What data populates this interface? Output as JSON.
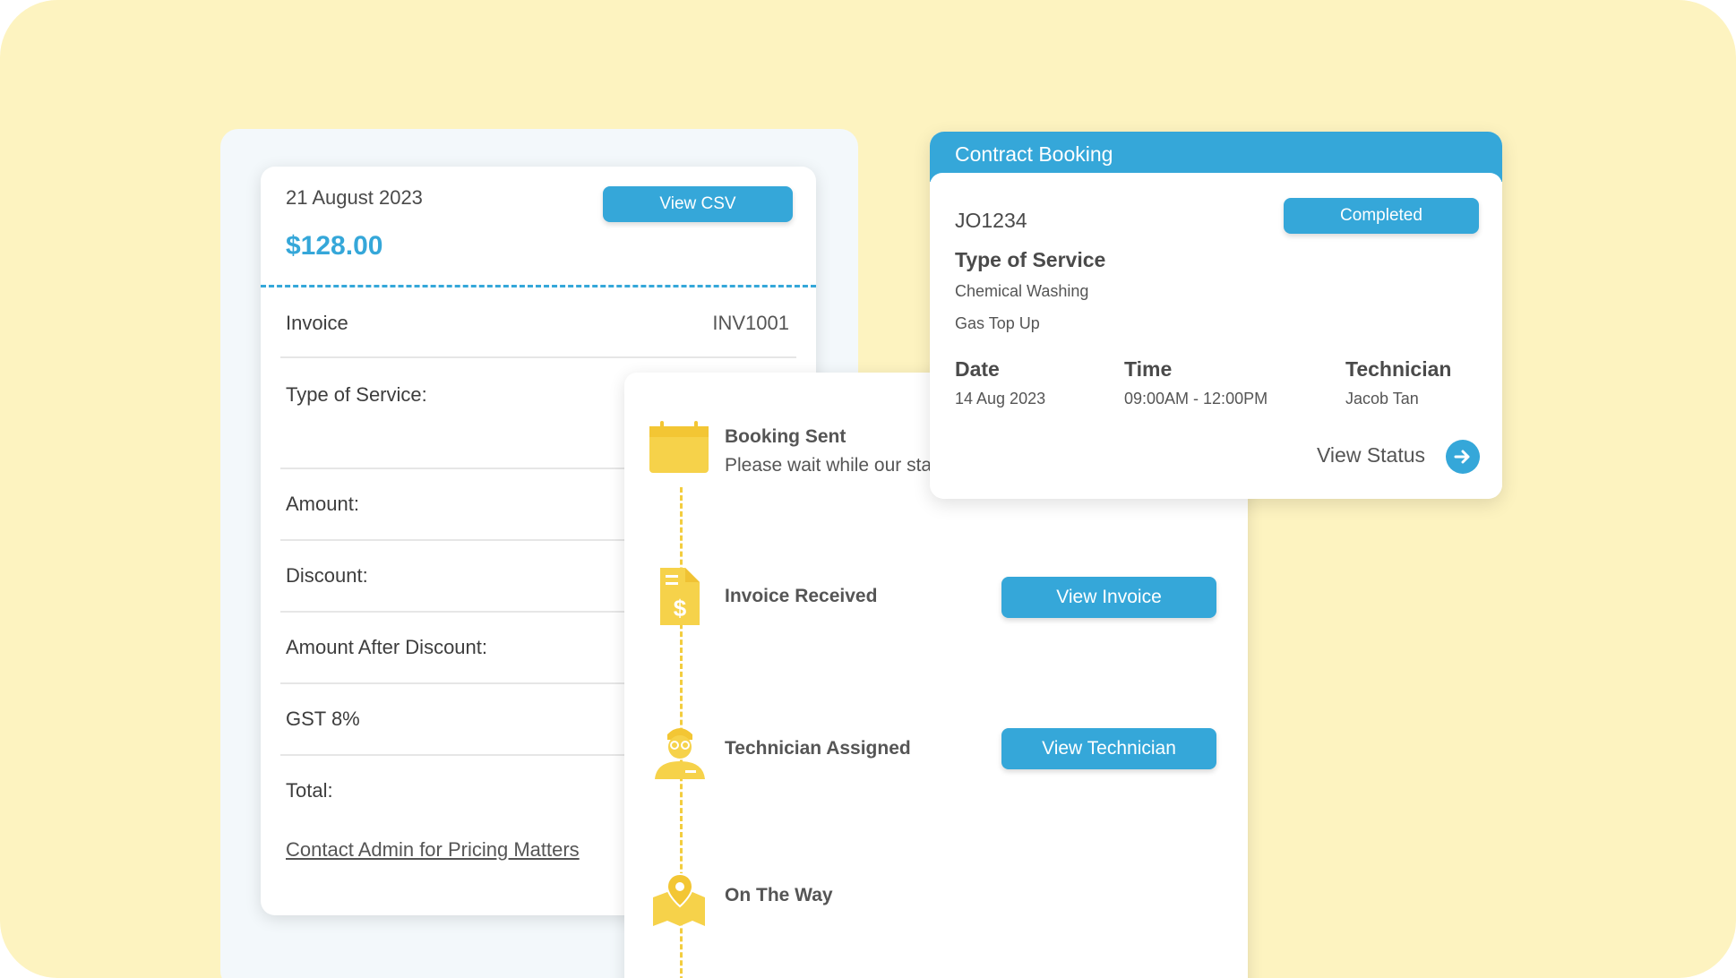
{
  "invoice": {
    "date": "21 August 2023",
    "amount": "$128.00",
    "view_csv_label": "View CSV",
    "rows": [
      {
        "label": "Invoice",
        "value": "INV1001"
      },
      {
        "label": "Type of Service:",
        "value": ""
      },
      {
        "label": "Amount:",
        "value": ""
      },
      {
        "label": "Discount:",
        "value": ""
      },
      {
        "label": "Amount After Discount:",
        "value": ""
      },
      {
        "label": "GST 8%",
        "value": ""
      },
      {
        "label": "Total:",
        "value": ""
      }
    ],
    "contact_link": "Contact Admin for Pricing Matters"
  },
  "timeline": {
    "steps": [
      {
        "title": "Booking Sent",
        "description": "Please wait while our sta",
        "icon": "calendar-icon"
      },
      {
        "title": "Invoice Received",
        "button": "View Invoice",
        "icon": "invoice-dollar-icon"
      },
      {
        "title": "Technician Assigned",
        "button": "View Technician",
        "icon": "technician-icon"
      },
      {
        "title": "On The Way",
        "icon": "map-pin-icon"
      }
    ]
  },
  "contract": {
    "title": "Contract Booking",
    "job_id": "JO1234",
    "status_label": "Completed",
    "service_heading": "Type of Service",
    "services": [
      "Chemical Washing",
      "Gas Top Up"
    ],
    "date_heading": "Date",
    "date_value": "14 Aug 2023",
    "time_heading": "Time",
    "time_value": "09:00AM - 12:00PM",
    "technician_heading": "Technician",
    "technician_value": "Jacob Tan",
    "view_status_label": "View Status"
  },
  "colors": {
    "background": "#fdf3c0",
    "accent_blue": "#35a7d9",
    "accent_yellow": "#f3cd3f"
  }
}
